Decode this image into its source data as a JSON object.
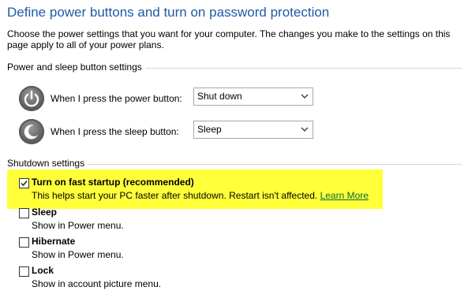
{
  "page": {
    "title": "Define power buttons and turn on password protection",
    "description": "Choose the power settings that you want for your computer. The changes you make to the settings on this page apply to all of your power plans."
  },
  "power_section": {
    "header": "Power and sleep button settings",
    "rows": [
      {
        "label": "When I press the power button:",
        "value": "Shut down",
        "icon": "power-icon"
      },
      {
        "label": "When I press the sleep button:",
        "value": "Sleep",
        "icon": "sleep-icon"
      }
    ]
  },
  "shutdown_section": {
    "header": "Shutdown settings",
    "items": [
      {
        "label": "Turn on fast startup (recommended)",
        "checked": true,
        "description": "This helps start your PC faster after shutdown. Restart isn't affected.",
        "link": "Learn More"
      },
      {
        "label": "Sleep",
        "checked": false,
        "description": "Show in Power menu."
      },
      {
        "label": "Hibernate",
        "checked": false,
        "description": "Show in Power menu."
      },
      {
        "label": "Lock",
        "checked": false,
        "description": "Show in account picture menu."
      }
    ]
  },
  "colors": {
    "title": "#1e5aa6",
    "highlight": "#ffff3a",
    "link": "#0b6b2f"
  }
}
